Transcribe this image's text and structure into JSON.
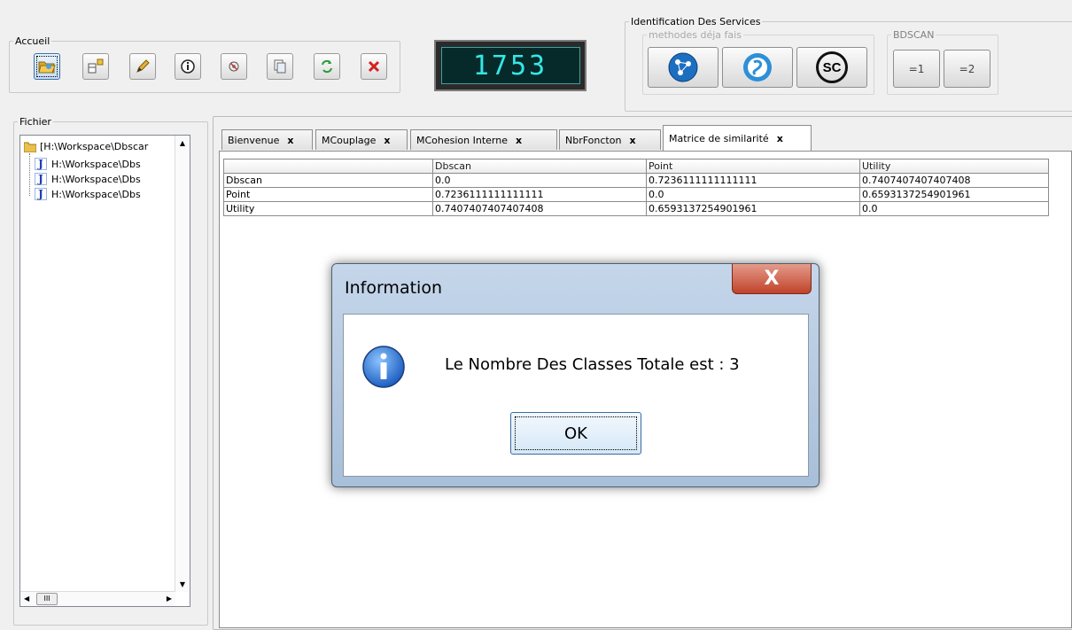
{
  "toolbar": {
    "group_label": "Accueil",
    "counter_value": "1753"
  },
  "services": {
    "group_label": "Identification Des Services",
    "methods_label": "methodes déja fais",
    "bdscan_label": "BDSCAN",
    "sc_label": "SC",
    "btn1_label": "=1",
    "btn2_label": "=2"
  },
  "explorer": {
    "group_label": "Fichier",
    "root_label": "[H:\\Workspace\\Dbscar",
    "items": [
      "H:\\Workspace\\Dbs",
      "H:\\Workspace\\Dbs",
      "H:\\Workspace\\Dbs"
    ],
    "hscroll_label": "III"
  },
  "tabs": [
    {
      "label": "Bienvenue"
    },
    {
      "label": "MCouplage"
    },
    {
      "label": "MCohesion Interne"
    },
    {
      "label": "NbrFoncton"
    },
    {
      "label": "Matrice de similarité"
    }
  ],
  "tab_close": "x",
  "matrix": {
    "columns": [
      "",
      "Dbscan",
      "Point",
      "Utility"
    ],
    "rows": [
      [
        "Dbscan",
        "0.0",
        "0.7236111111111111",
        "0.7407407407407408"
      ],
      [
        "Point",
        "0.7236111111111111",
        "0.0",
        "0.6593137254901961"
      ],
      [
        "Utility",
        "0.7407407407407408",
        "0.6593137254901961",
        "0.0"
      ]
    ]
  },
  "dialog": {
    "title": "Information",
    "message": "Le Nombre Des Classes Totale est : 3",
    "ok_label": "OK",
    "close_label": "X"
  },
  "colors": {
    "lcd_text": "#35e6e6",
    "info_icon": "#1f5fc0",
    "delete_icon": "#d42020"
  }
}
